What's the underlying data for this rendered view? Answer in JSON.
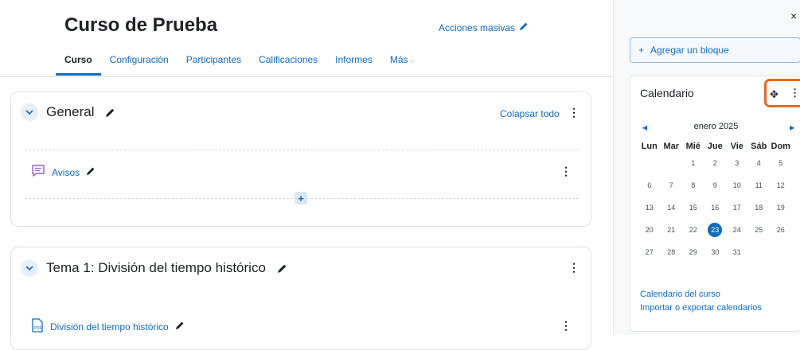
{
  "course": {
    "title": "Curso de Prueba",
    "bulk_actions": "Acciones masivas"
  },
  "nav": {
    "tabs": [
      "Curso",
      "Configuración",
      "Participantes",
      "Calificaciones",
      "Informes",
      "Más"
    ]
  },
  "sections": [
    {
      "title": "General",
      "collapse_all": "Colapsar todo",
      "activity": {
        "label": "Avisos",
        "icon": "forum-icon"
      }
    },
    {
      "title": "Tema 1: División del tiempo histórico",
      "activity": {
        "label": "División del tiempo histórico",
        "icon": "pdf-icon"
      }
    }
  ],
  "drawer": {
    "close_icon": "×",
    "add_block": "Agregar un bloque",
    "calendar": {
      "title": "Calendario",
      "month": "enero 2025",
      "weekdays": [
        "Lun",
        "Mar",
        "Mié",
        "Jue",
        "Vie",
        "Sáb",
        "Dom"
      ],
      "weeks": [
        [
          "",
          "",
          "1",
          "2",
          "3",
          "4",
          "5"
        ],
        [
          "6",
          "7",
          "8",
          "9",
          "10",
          "11",
          "12"
        ],
        [
          "13",
          "14",
          "15",
          "16",
          "17",
          "18",
          "19"
        ],
        [
          "20",
          "21",
          "22",
          "23",
          "24",
          "25",
          "26"
        ],
        [
          "27",
          "28",
          "29",
          "30",
          "31",
          "",
          ""
        ]
      ],
      "today": "23",
      "links": [
        "Calendario del curso",
        "Importar o exportar calendarios"
      ]
    }
  },
  "colors": {
    "accent": "#0f6cbf",
    "highlight": "#e8681b",
    "forum_icon": "#9a5ccc",
    "pdf_icon": "#0f6cbf"
  }
}
